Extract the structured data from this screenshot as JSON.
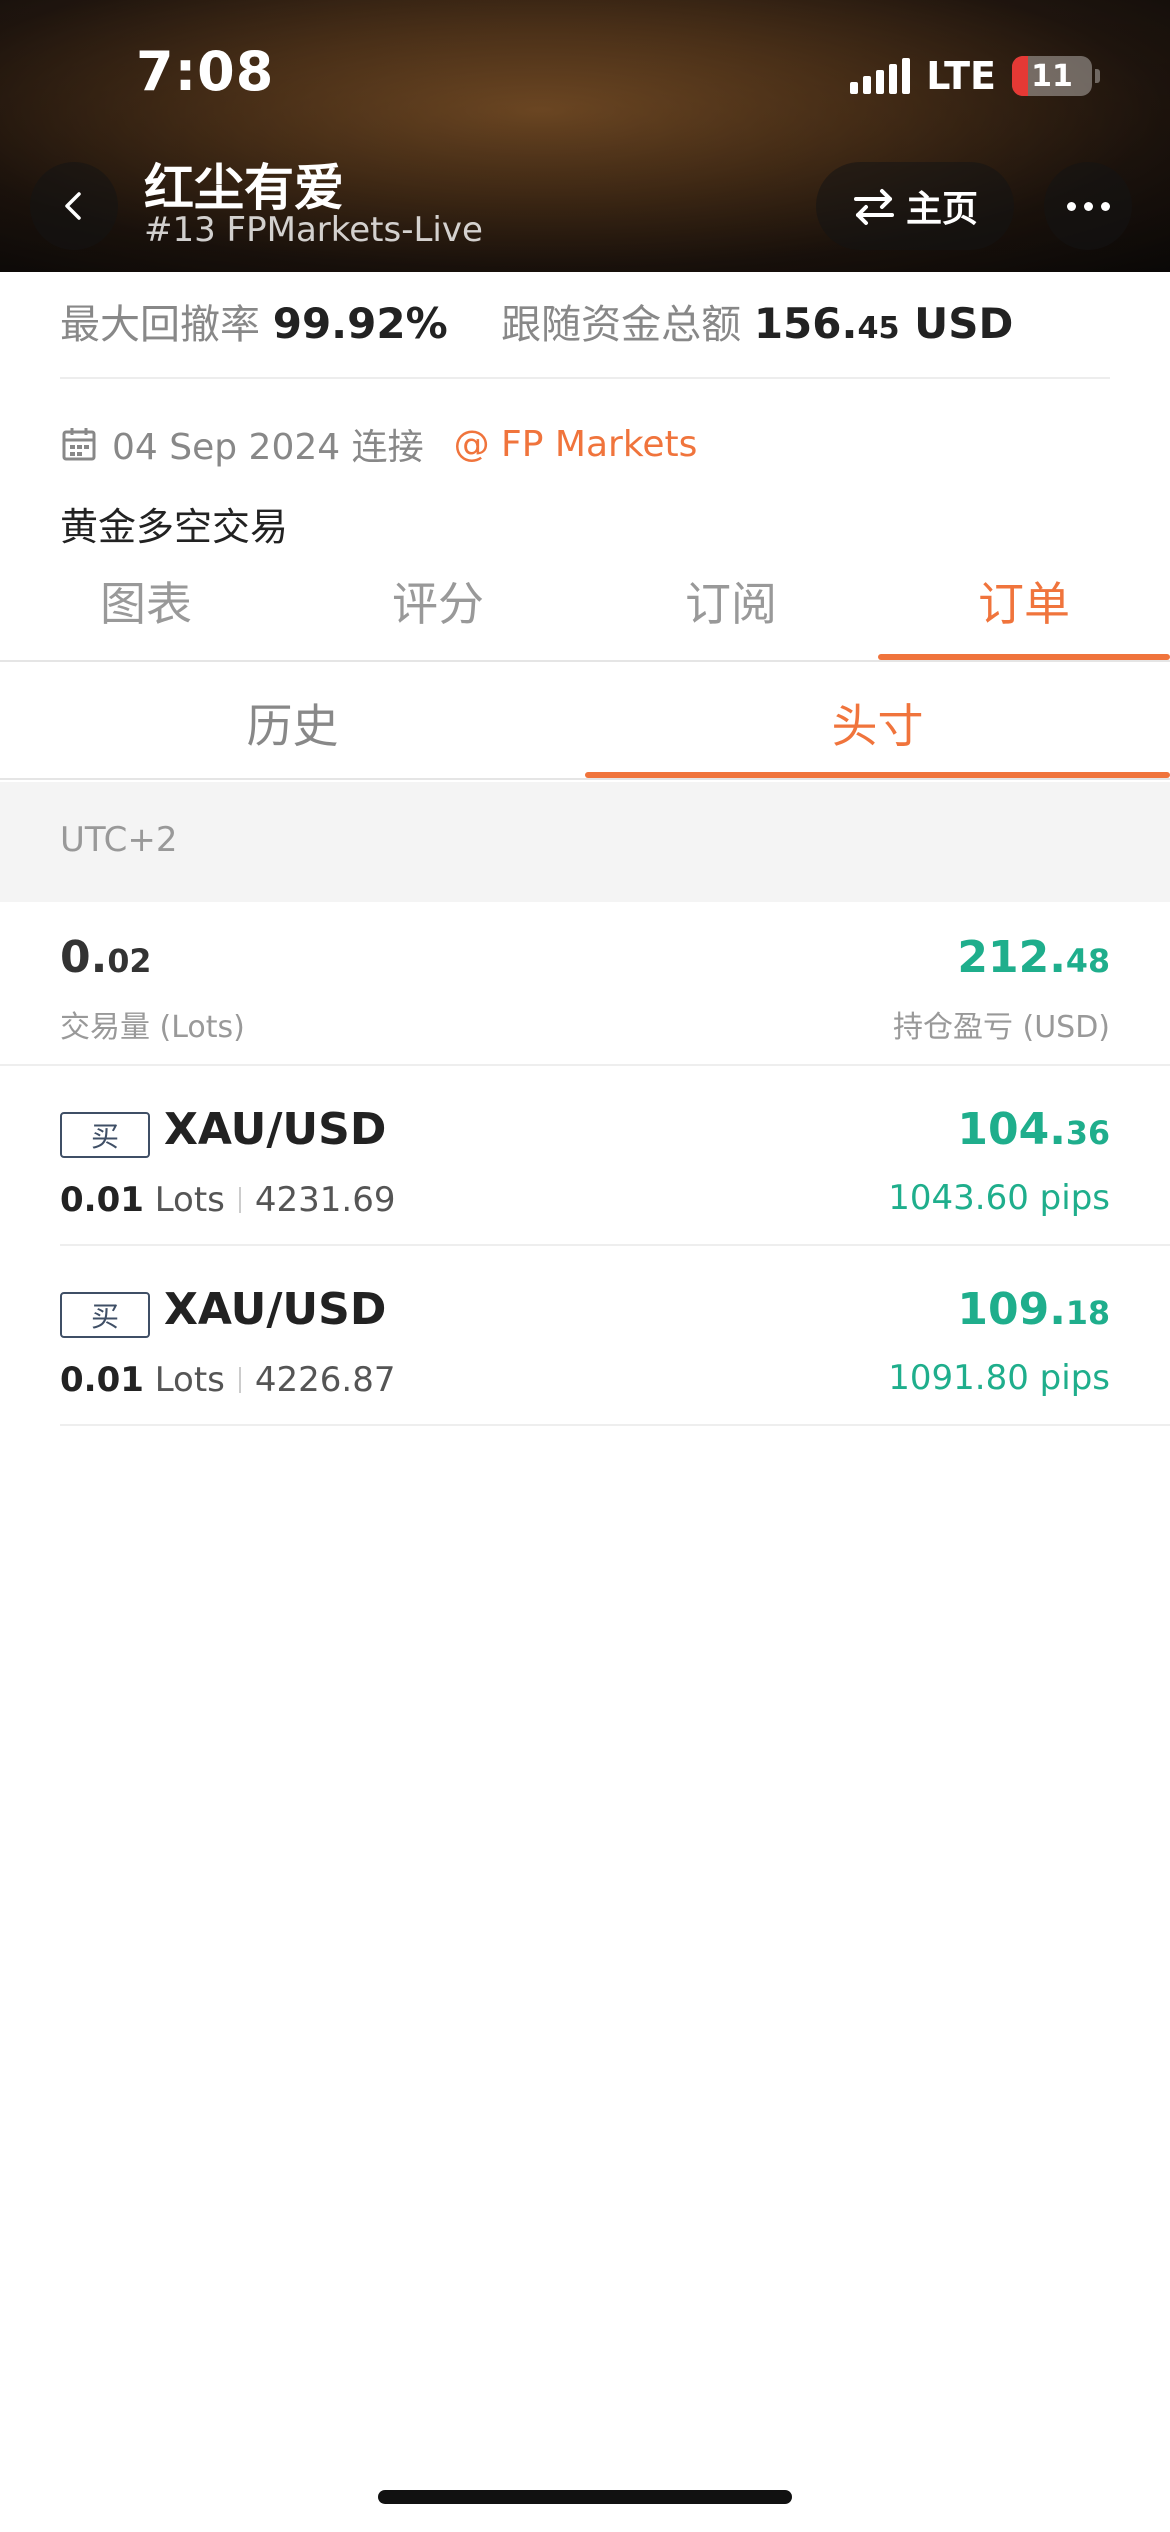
{
  "status_bar": {
    "time": "7:08",
    "network": "LTE",
    "battery": "11"
  },
  "header": {
    "title": "红尘有爱",
    "subtitle": "#13 FPMarkets-Live",
    "home_label": "主页"
  },
  "stats": {
    "drawdown_label": "最大回撤率",
    "drawdown_value": "99.92%",
    "funds_label": "跟随资金总额",
    "funds_value_main": "156.",
    "funds_value_decimal": "45",
    "funds_currency": " USD"
  },
  "meta": {
    "connected": "04 Sep 2024 连接",
    "broker": "@ FP Markets",
    "description": "黄金多空交易"
  },
  "tabs": [
    "图表",
    "评分",
    "订阅",
    "订单"
  ],
  "subtabs": [
    "历史",
    "头寸"
  ],
  "timezone": "UTC+2",
  "summary": {
    "volume_main": "0.",
    "volume_decimal": "02",
    "volume_label": "交易量 (Lots)",
    "pnl_main": "212.",
    "pnl_decimal": "48",
    "pnl_label": "持仓盈亏 (USD)"
  },
  "positions": [
    {
      "side": "买",
      "symbol": "XAU/USD",
      "lots": "0.01",
      "lots_unit": " Lots",
      "price": "4231.69",
      "pnl_main": "104.",
      "pnl_decimal": "36",
      "pips": "1043.60 pips"
    },
    {
      "side": "买",
      "symbol": "XAU/USD",
      "lots": "0.01",
      "lots_unit": " Lots",
      "price": "4226.87",
      "pnl_main": "109.",
      "pnl_decimal": "18",
      "pips": "1091.80 pips"
    }
  ],
  "colors": {
    "accent": "#f0743c",
    "profit": "#1fae8c"
  },
  "icons": [
    "back-icon",
    "swap-icon",
    "more-icon",
    "calendar-icon"
  ]
}
